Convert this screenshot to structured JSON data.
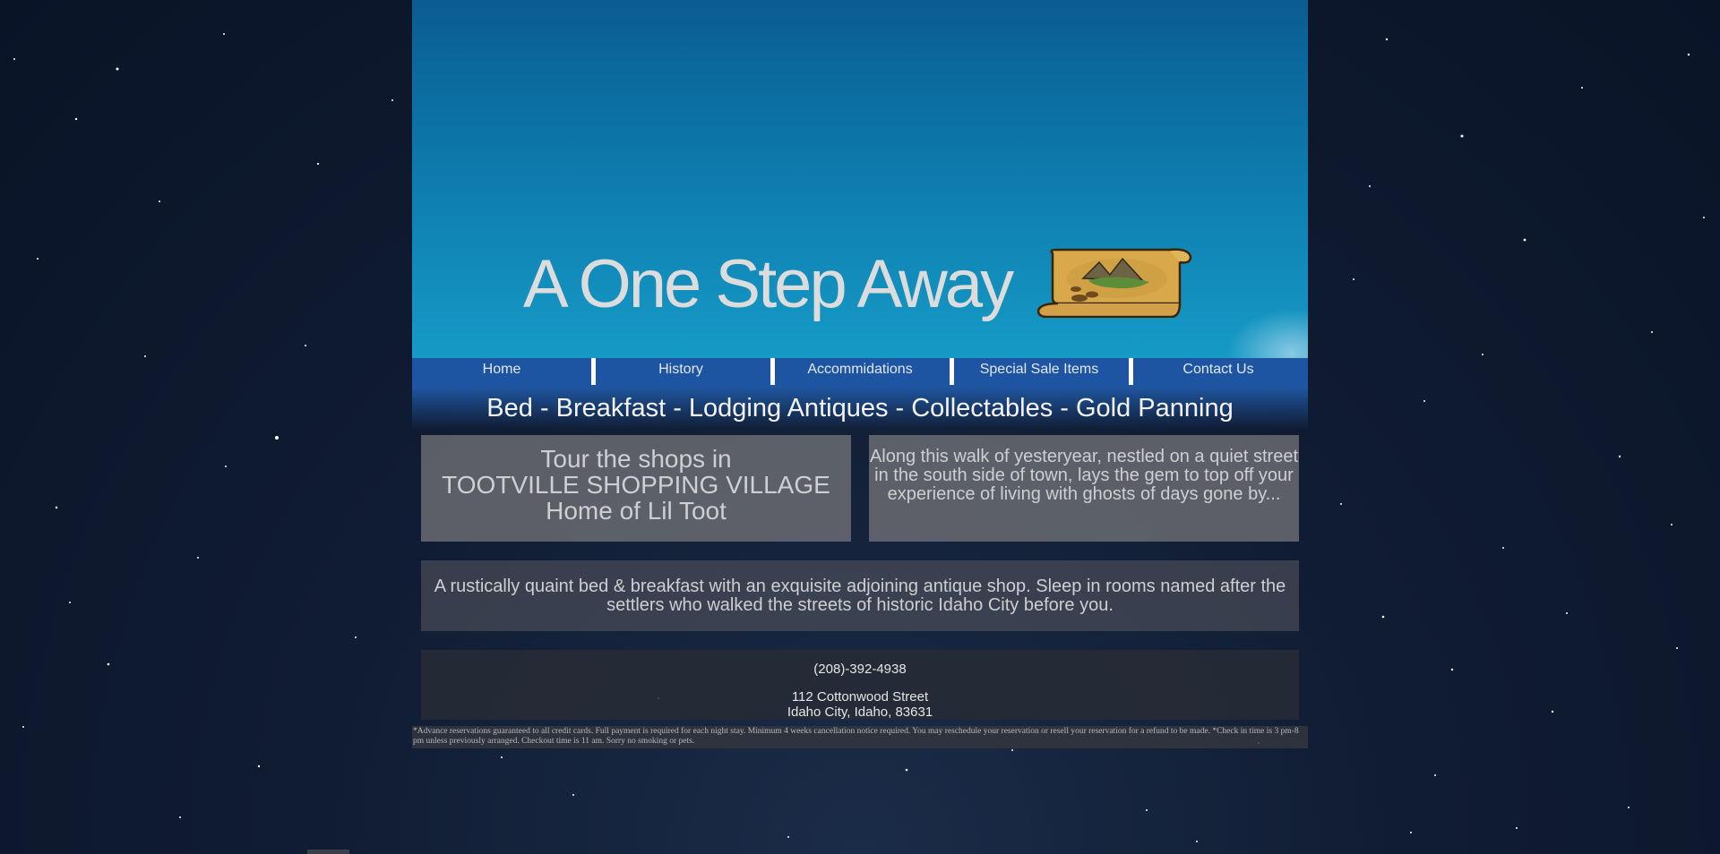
{
  "header": {
    "title": "A One Step Away"
  },
  "nav": {
    "items": [
      {
        "label": "Home"
      },
      {
        "label": "History"
      },
      {
        "label": "Accommidations"
      },
      {
        "label": "Special Sale Items"
      },
      {
        "label": "Contact Us"
      }
    ]
  },
  "tagline": "Bed - Breakfast - Lodging Antiques - Collectables - Gold Panning",
  "panels": {
    "shops": {
      "line1": "Tour the shops in",
      "line2": "TOOTVILLE SHOPPING VILLAGE",
      "line3": "Home of Lil Toot"
    },
    "walk": "Along this walk of yesteryear, nestled on a quiet street in the south side of town, lays the gem to top off your experience of living with ghosts of days gone by...",
    "description": "A rustically quaint bed & breakfast with an exquisite adjoining antique shop. Sleep in rooms named after the settlers who walked the streets of historic Idaho City before you."
  },
  "contact": {
    "phone": "(208)-392-4938",
    "street": "112 Cottonwood Street",
    "city": "Idaho City, Idaho, 83631"
  },
  "fine_print": "*Advance reservations guaranteed to all credit cards. Full payment is required for each night stay. Minimum 4 weeks cancellation notice required. You may reschedule your reservation or resell your reservation for a refund to be made. *Check in time is 3 pm-8 pm unless previously arranged. Checkout time is 11 am. Sorry no smoking or pets.",
  "colors": {
    "nav_bar": "#1d55a3",
    "header_top": "#0a5c92",
    "header_bottom": "#169ac6",
    "background": "#101c33"
  },
  "icons": {
    "logo": "treasure-map-scroll-icon"
  }
}
